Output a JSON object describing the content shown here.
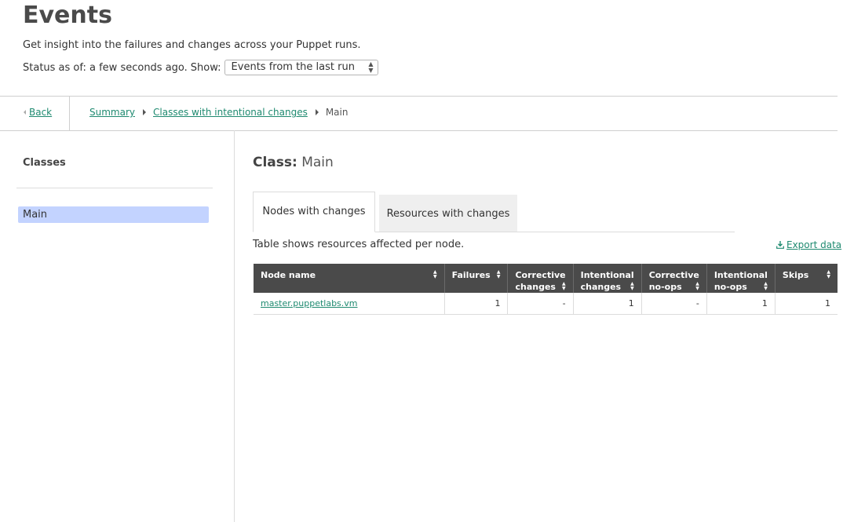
{
  "header": {
    "title": "Events",
    "subtitle": "Get insight into the failures and changes across your Puppet runs.",
    "status_text": "Status as of: a few seconds ago.",
    "show_label": "Show:",
    "show_select_value": "Events from the last run"
  },
  "breadcrumb": {
    "back_label": "Back",
    "items": [
      "Summary",
      "Classes with intentional changes"
    ],
    "current": "Main"
  },
  "sidebar": {
    "title": "Classes",
    "items": [
      {
        "label": "Main",
        "selected": true
      }
    ]
  },
  "main": {
    "class_prefix": "Class:",
    "class_name": "Main",
    "tabs": [
      {
        "label": "Nodes with changes",
        "active": true
      },
      {
        "label": "Resources with changes",
        "active": false
      }
    ],
    "table_caption": "Table shows resources affected per node.",
    "export_label": "Export data",
    "table": {
      "headers": [
        {
          "line1": "Node name",
          "line2": ""
        },
        {
          "line1": "Failures",
          "line2": ""
        },
        {
          "line1": "Corrective",
          "line2": "changes"
        },
        {
          "line1": "Intentional",
          "line2": "changes"
        },
        {
          "line1": "Corrective",
          "line2": "no-ops"
        },
        {
          "line1": "Intentional",
          "line2": "no-ops"
        },
        {
          "line1": "Skips",
          "line2": ""
        }
      ],
      "rows": [
        [
          "master.puppetlabs.vm",
          "1",
          "-",
          "1",
          "-",
          "1",
          "1"
        ]
      ]
    }
  },
  "colors": {
    "link": "#1f8a70",
    "table_header_bg": "#4a4a4a",
    "selected_item_bg": "#c3d3ff"
  }
}
